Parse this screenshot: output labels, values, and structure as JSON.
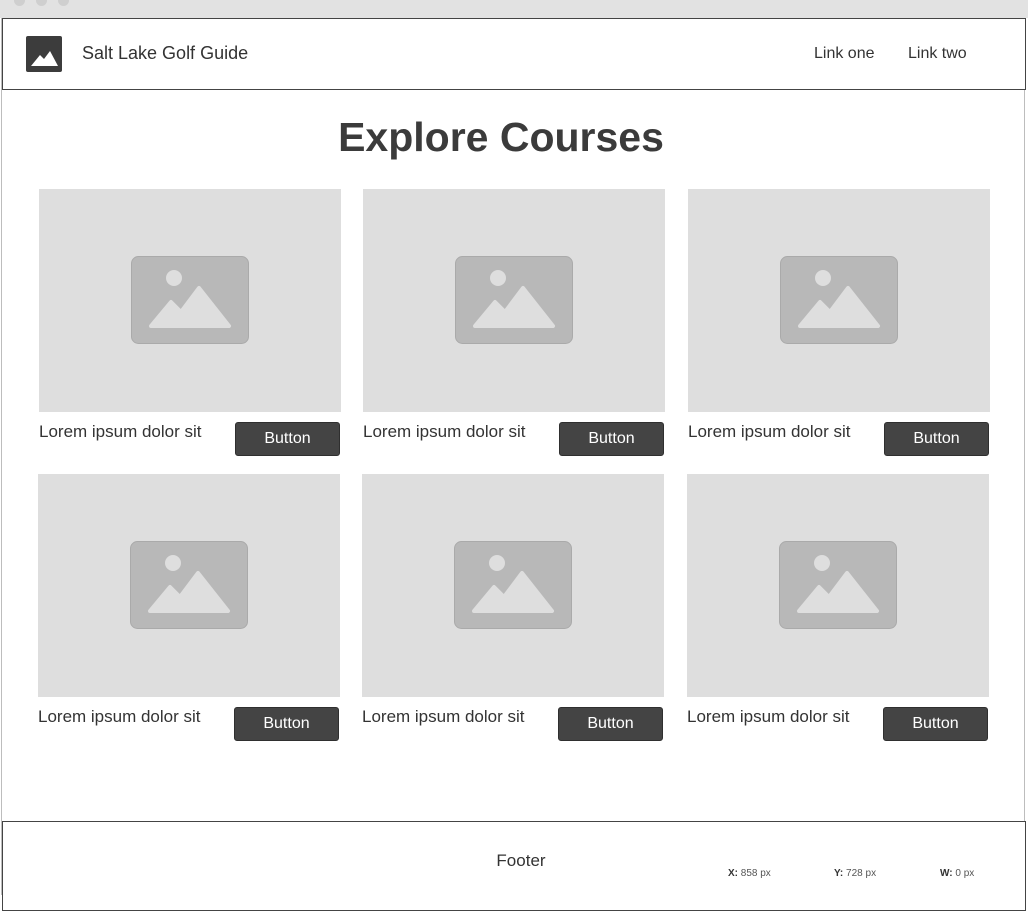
{
  "header": {
    "site_title": "Salt Lake Golf Guide",
    "logo_icon": "image-icon",
    "nav": [
      {
        "label": "Link one"
      },
      {
        "label": "Link two"
      }
    ]
  },
  "main": {
    "heading": "Explore Courses",
    "cards": [
      {
        "caption": "Lorem ipsum dolor sit",
        "button_label": "Button",
        "image_icon": "image-placeholder-icon"
      },
      {
        "caption": "Lorem ipsum dolor sit",
        "button_label": "Button",
        "image_icon": "image-placeholder-icon"
      },
      {
        "caption": "Lorem ipsum dolor sit",
        "button_label": "Button",
        "image_icon": "image-placeholder-icon"
      },
      {
        "caption": "Lorem ipsum dolor sit",
        "button_label": "Button",
        "image_icon": "image-placeholder-icon"
      },
      {
        "caption": "Lorem ipsum dolor sit",
        "button_label": "Button",
        "image_icon": "image-placeholder-icon"
      },
      {
        "caption": "Lorem ipsum dolor sit",
        "button_label": "Button",
        "image_icon": "image-placeholder-icon"
      }
    ]
  },
  "footer": {
    "label": "Footer"
  },
  "readout": {
    "x_label": "X:",
    "x_value": "858 px",
    "y_label": "Y:",
    "y_value": "728 px",
    "w_label": "W:",
    "w_value": "0 px"
  },
  "colors": {
    "button_bg": "#444444",
    "placeholder_bg": "#dedede",
    "placeholder_icon": "#b8b8b8",
    "text": "#333333"
  }
}
